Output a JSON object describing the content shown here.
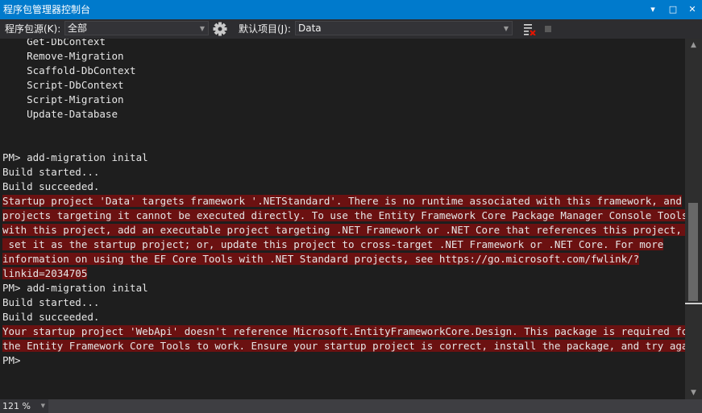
{
  "window": {
    "title": "程序包管理器控制台",
    "buttons": [
      "▾",
      "□",
      "✕"
    ]
  },
  "toolbar": {
    "source_label": "程序包源(K):",
    "source_value": "全部",
    "project_label": "默认项目(J):",
    "project_value": "Data"
  },
  "console": {
    "lines": [
      {
        "text": "    Get-DbContext",
        "error": false
      },
      {
        "text": "    Remove-Migration",
        "error": false
      },
      {
        "text": "    Scaffold-DbContext",
        "error": false
      },
      {
        "text": "    Script-DbContext",
        "error": false
      },
      {
        "text": "    Script-Migration",
        "error": false
      },
      {
        "text": "    Update-Database",
        "error": false
      },
      {
        "text": "",
        "error": false
      },
      {
        "text": "",
        "error": false
      },
      {
        "text": "PM> add-migration inital",
        "error": false
      },
      {
        "text": "Build started...",
        "error": false
      },
      {
        "text": "Build succeeded.",
        "error": false
      },
      {
        "text": "Startup project 'Data' targets framework '.NETStandard'. There is no runtime associated with this framework, and",
        "error": true
      },
      {
        "text": "projects targeting it cannot be executed directly. To use the Entity Framework Core Package Manager Console Tools",
        "error": true
      },
      {
        "text": "with this project, add an executable project targeting .NET Framework or .NET Core that references this project, and",
        "error": true
      },
      {
        "text": " set it as the startup project; or, update this project to cross-target .NET Framework or .NET Core. For more",
        "error": true
      },
      {
        "text": "information on using the EF Core Tools with .NET Standard projects, see https://go.microsoft.com/fwlink/?",
        "error": true
      },
      {
        "text": "linkid=2034705",
        "error": true
      },
      {
        "text": "PM> add-migration inital",
        "error": false
      },
      {
        "text": "Build started...",
        "error": false
      },
      {
        "text": "Build succeeded.",
        "error": false
      },
      {
        "text": "Your startup project 'WebApi' doesn't reference Microsoft.EntityFrameworkCore.Design. This package is required for",
        "error": true
      },
      {
        "text": "the Entity Framework Core Tools to work. Ensure your startup project is correct, install the package, and try again.",
        "error": true
      },
      {
        "text": "PM>",
        "error": false
      }
    ]
  },
  "status": {
    "zoom": "121 %"
  }
}
